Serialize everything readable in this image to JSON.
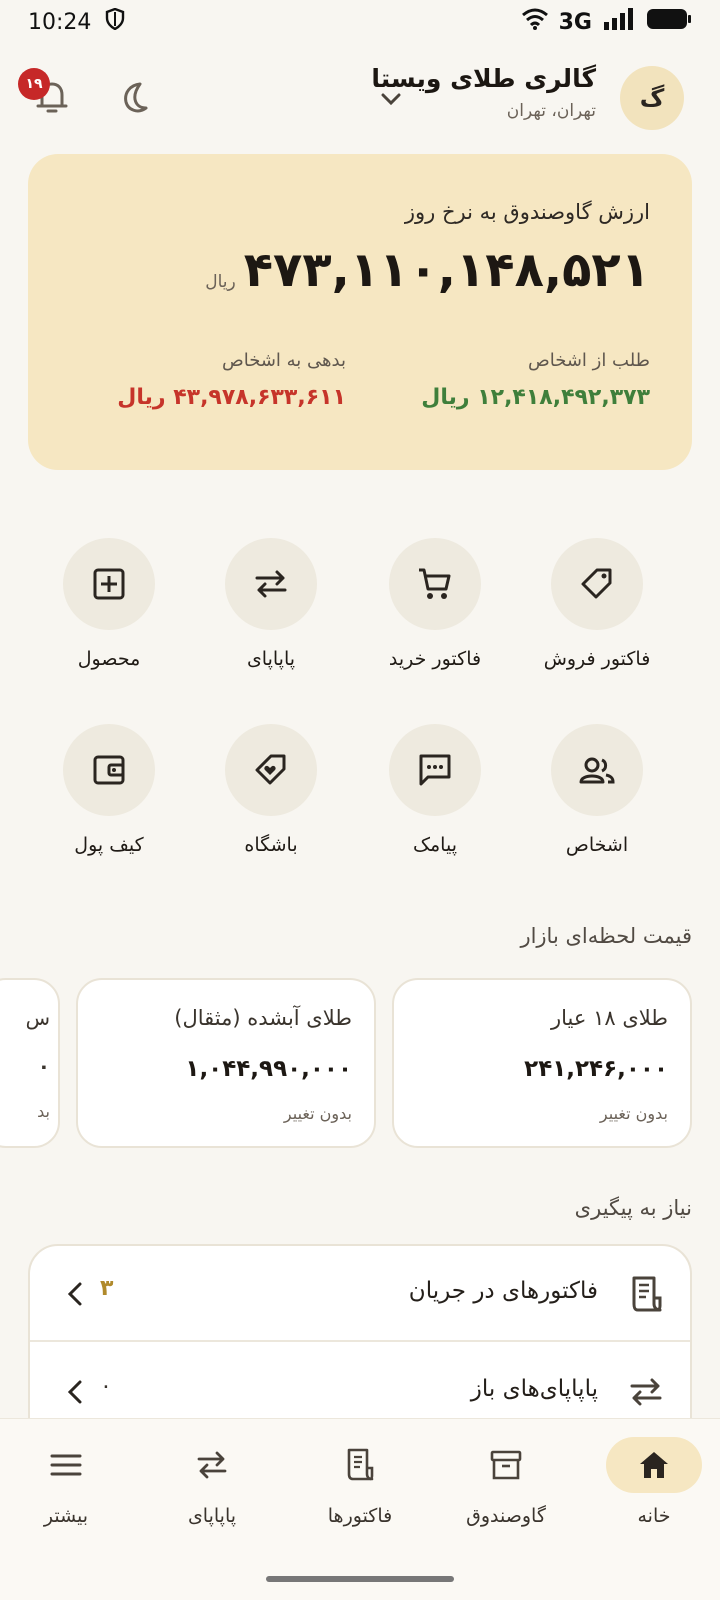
{
  "status_bar": {
    "time": "10:24",
    "network": "3G"
  },
  "header": {
    "store_name": "گالری طلای ویستا",
    "store_location": "تهران، تهران",
    "avatar_letter": "گ",
    "notification_count": "۱۹"
  },
  "balance": {
    "title": "ارزش گاوصندوق به نرخ روز",
    "amount": "۴۷۳,۱۱۰,۱۴۸,۵۲۱",
    "unit": "ریال",
    "receivable_label": "طلب از اشخاص",
    "receivable_value": "۱۲,۴۱۸,۴۹۲,۳۷۳ ریال",
    "debt_label": "بدهی به اشخاص",
    "debt_value": "۴۳,۹۷۸,۶۳۳,۶۱۱ ریال"
  },
  "actions": [
    {
      "label": "فاکتور فروش",
      "icon": "tag-icon"
    },
    {
      "label": "فاکتور خرید",
      "icon": "cart-icon"
    },
    {
      "label": "پاپاپای",
      "icon": "swap-icon"
    },
    {
      "label": "محصول",
      "icon": "add-box-icon"
    },
    {
      "label": "اشخاص",
      "icon": "people-icon"
    },
    {
      "label": "پیامک",
      "icon": "sms-icon"
    },
    {
      "label": "باشگاه",
      "icon": "loyalty-icon"
    },
    {
      "label": "کیف پول",
      "icon": "wallet-icon"
    }
  ],
  "market": {
    "title": "قیمت لحظه‌ای بازار",
    "cards": [
      {
        "name": "طلای ۱۸ عیار",
        "value": "۲۴۱,۲۴۶,۰۰۰",
        "change": "بدون تغییر"
      },
      {
        "name": "طلای آبشده (مثقال)",
        "value": "۱,۰۴۴,۹۹۰,۰۰۰",
        "change": "بدون تغییر"
      }
    ],
    "partial": {
      "name": "س",
      "value": "۰",
      "change": "بد"
    }
  },
  "followup": {
    "title": "نیاز به پیگیری",
    "rows": [
      {
        "label": "فاکتورهای در جریان",
        "count": "۳"
      },
      {
        "label": "پاپاپای‌های باز",
        "count": "۰"
      }
    ]
  },
  "nav": [
    {
      "label": "خانه",
      "icon": "home-icon",
      "active": true
    },
    {
      "label": "گاوصندوق",
      "icon": "archive-icon"
    },
    {
      "label": "فاکتورها",
      "icon": "receipt-icon"
    },
    {
      "label": "پاپاپای",
      "icon": "swap-icon"
    },
    {
      "label": "بیشتر",
      "icon": "menu-icon"
    }
  ],
  "colors": {
    "accent": "#f6e7c2",
    "positive": "#3f7f3b",
    "negative": "#c6342a",
    "badge": "#c62828"
  }
}
